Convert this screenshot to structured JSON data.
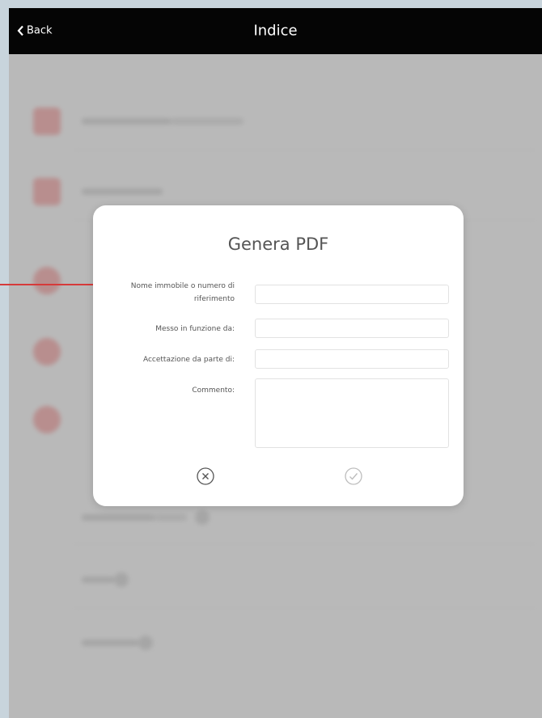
{
  "navbar": {
    "back_label": "Back",
    "title": "Indice"
  },
  "dialog": {
    "title": "Genera PDF",
    "fields": [
      {
        "label": "Nome immobile o numero di riferimento",
        "value": "",
        "placeholder": ""
      },
      {
        "label": "Messo in funzione da:",
        "value": "",
        "placeholder": ""
      },
      {
        "label": "Accettazione da parte di:",
        "value": "",
        "placeholder": ""
      },
      {
        "label": "Commento:",
        "value": "",
        "placeholder": ""
      }
    ],
    "cancel_icon": "close-circle-icon",
    "confirm_icon": "check-circle-icon"
  },
  "colors": {
    "accent": "#d63a3a",
    "navbar": "#050505"
  }
}
